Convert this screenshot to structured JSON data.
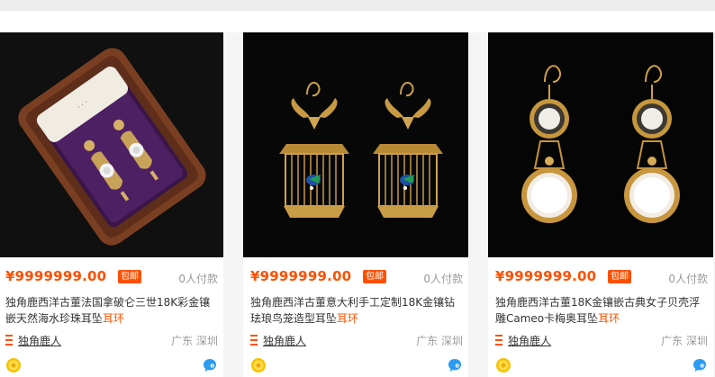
{
  "products": [
    {
      "price": "¥9999999.00",
      "badge": "包邮",
      "sold": "0人付款",
      "title_main": "独角鹿西洋古董法国拿破仑三世18K彩金镶嵌天然海水珍珠耳坠",
      "title_highlight": "耳环",
      "shop": "独角鹿人",
      "location": "广东 深圳",
      "image_icon": "earring-box-image"
    },
    {
      "price": "¥9999999.00",
      "badge": "包邮",
      "sold": "0人付款",
      "title_main": "独角鹿西洋古董意大利手工定制18K金镶钻珐琅鸟笼造型耳坠",
      "title_highlight": "耳环",
      "shop": "独角鹿人",
      "location": "广东 深圳",
      "image_icon": "birdcage-earring-image"
    },
    {
      "price": "¥9999999.00",
      "badge": "包邮",
      "sold": "0人付款",
      "title_main": "独角鹿西洋古董18K金镶嵌古典女子贝壳浮雕Cameo卡梅奥耳坠",
      "title_highlight": "耳环",
      "shop": "独角鹿人",
      "location": "广东 深圳",
      "image_icon": "cameo-earring-image"
    }
  ],
  "colors": {
    "accent": "#ff5000",
    "page_bg": "#f5f5f5",
    "card_bg": "#ffffff"
  },
  "icons": {
    "shop": "shop-icon",
    "medal": "gold-medal-icon",
    "chat": "wangwang-chat-icon"
  }
}
